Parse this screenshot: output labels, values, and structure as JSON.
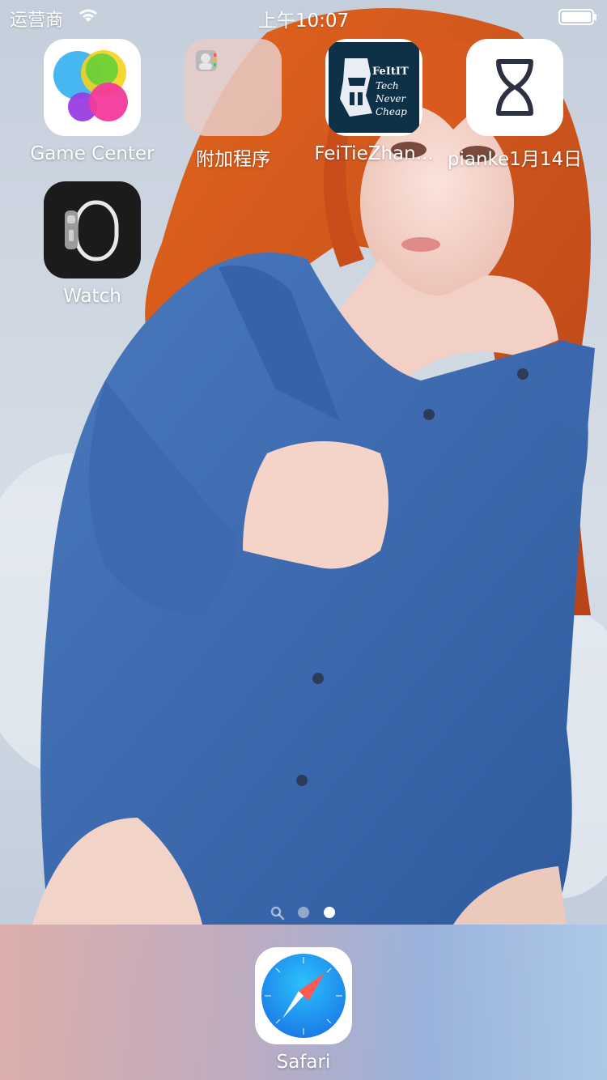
{
  "status_bar": {
    "carrier": "运营商",
    "time": "上午10:07"
  },
  "apps": [
    {
      "label": "Game Center",
      "icon": "game-center-icon"
    },
    {
      "label": "附加程序",
      "icon": "folder-icon"
    },
    {
      "label": "FeiTieZhan...",
      "icon": "feitiezhan-icon",
      "icon_text": [
        "FeItIT",
        "Tech",
        "Never",
        "Cheap"
      ]
    },
    {
      "label": "pianke1月14日",
      "icon": "hourglass-icon"
    },
    {
      "label": "Watch",
      "icon": "watch-icon"
    }
  ],
  "dock": {
    "apps": [
      {
        "label": "Safari",
        "icon": "safari-compass-icon"
      }
    ]
  },
  "page_indicator": {
    "pages": 2,
    "current": 2
  },
  "colors": {
    "wallpaper_sky": "#cfd8e3",
    "hair": "#d4531c",
    "shirt": "#3f6db4",
    "safari_blue": "#1e8ef5"
  }
}
